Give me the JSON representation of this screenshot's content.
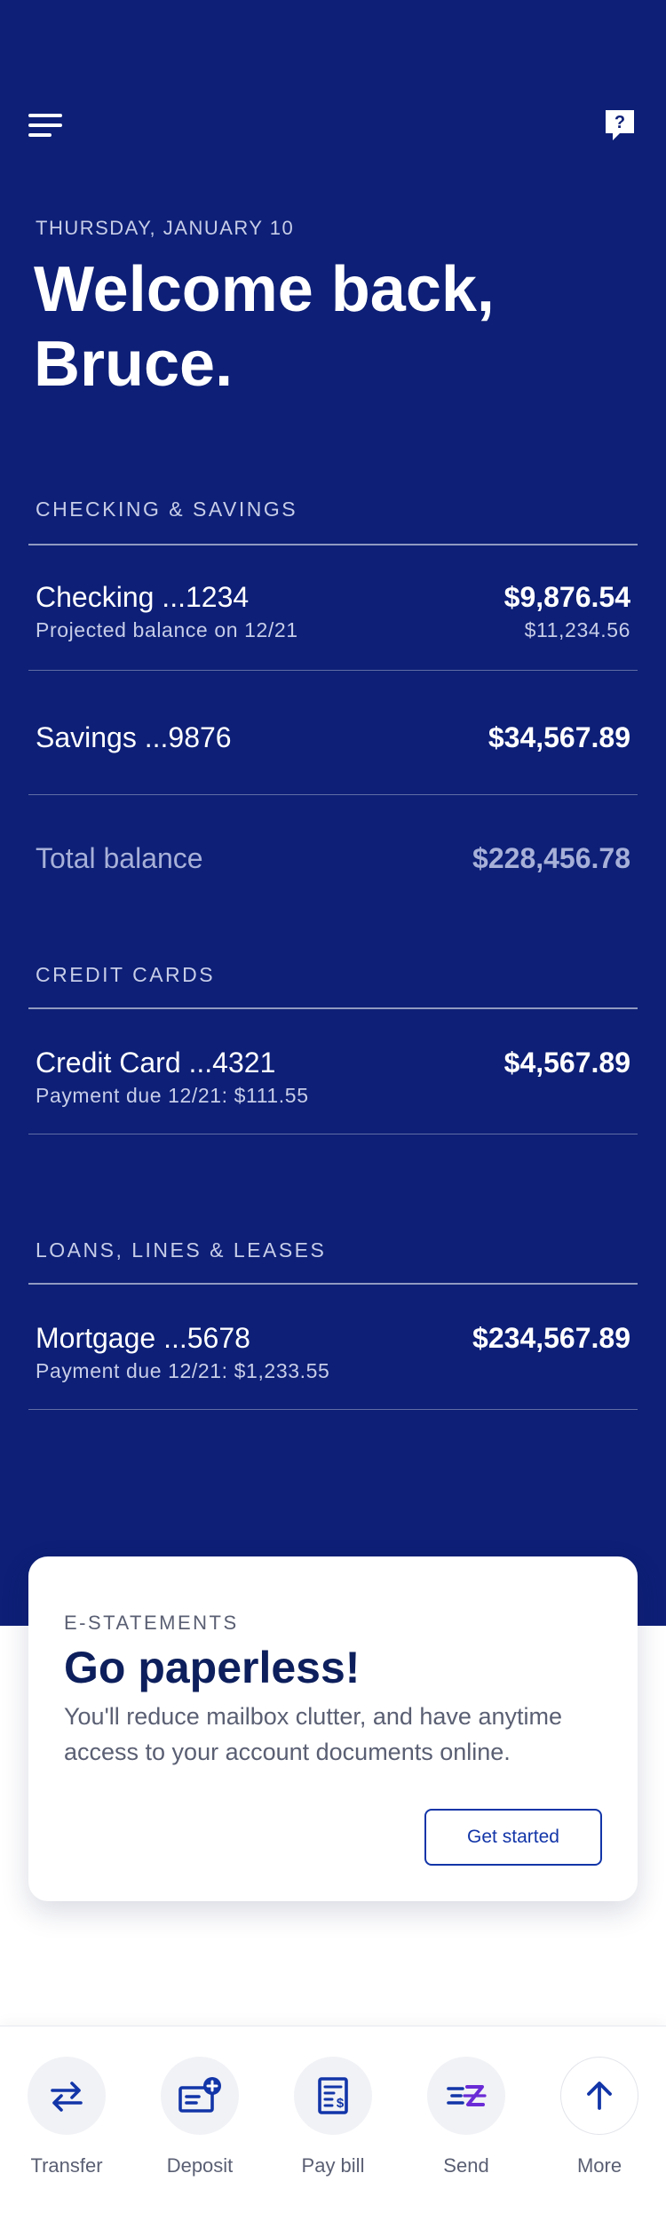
{
  "header": {
    "date": "THURSDAY, JANUARY 10",
    "welcome": "Welcome back, Bruce."
  },
  "checking_savings": {
    "title": "CHECKING & SAVINGS",
    "accounts": [
      {
        "name": "Checking ...1234",
        "sub": "Projected balance on 12/21",
        "amount": "$9,876.54",
        "sub_amount": "$11,234.56"
      },
      {
        "name": "Savings ...9876",
        "amount": "$34,567.89"
      }
    ],
    "total_label": "Total balance",
    "total_amount": "$228,456.78"
  },
  "credit_cards": {
    "title": "CREDIT CARDS",
    "accounts": [
      {
        "name": "Credit Card ...4321",
        "sub": "Payment due 12/21: $111.55",
        "amount": "$4,567.89"
      }
    ]
  },
  "loans": {
    "title": "LOANS, LINES & LEASES",
    "accounts": [
      {
        "name": "Mortgage ...5678",
        "sub": "Payment due 12/21: $1,233.55",
        "amount": "$234,567.89"
      }
    ]
  },
  "promo": {
    "eyebrow": "E-STATEMENTS",
    "title": "Go paperless!",
    "body": "You'll reduce mailbox clutter, and have anytime access to your account documents online.",
    "button": "Get started"
  },
  "tabbar": {
    "items": [
      {
        "label": "Transfer",
        "icon": "transfer-icon"
      },
      {
        "label": "Deposit",
        "icon": "deposit-icon"
      },
      {
        "label": "Pay bill",
        "icon": "pay-bill-icon"
      },
      {
        "label": "Send",
        "icon": "send-icon"
      },
      {
        "label": "More",
        "icon": "arrow-up-icon"
      }
    ]
  },
  "colors": {
    "brand_navy": "#0d1f76",
    "accent_blue": "#1235a8",
    "accent_purple": "#6a2bd6"
  }
}
